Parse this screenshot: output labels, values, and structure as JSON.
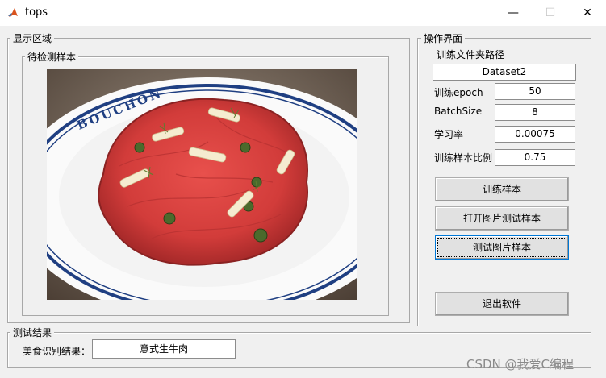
{
  "window": {
    "title": "tops",
    "minimize": "—",
    "maximize": "☐",
    "close": "✕"
  },
  "display_panel": {
    "label": "显示区域",
    "image_panel": {
      "label": "待检测样本",
      "image_text": "BOUCHON"
    }
  },
  "ops_panel": {
    "label": "操作界面",
    "folder_label": "训练文件夹路径",
    "folder_value": "Dataset2",
    "epoch_label": "训练epoch",
    "epoch_value": "50",
    "batch_label": "BatchSize",
    "batch_value": "8",
    "lr_label": "学习率",
    "lr_value": "0.00075",
    "ratio_label": "训练样本比例",
    "ratio_value": "0.75",
    "buttons": {
      "train": "训练样本",
      "open_test": "打开图片测试样本",
      "test": "测试图片样本",
      "exit": "退出软件"
    }
  },
  "result_panel": {
    "label": "测试结果",
    "result_label": "美食识别结果：",
    "result_value": "意式生牛肉"
  },
  "watermark": "CSDN @我爱C编程"
}
